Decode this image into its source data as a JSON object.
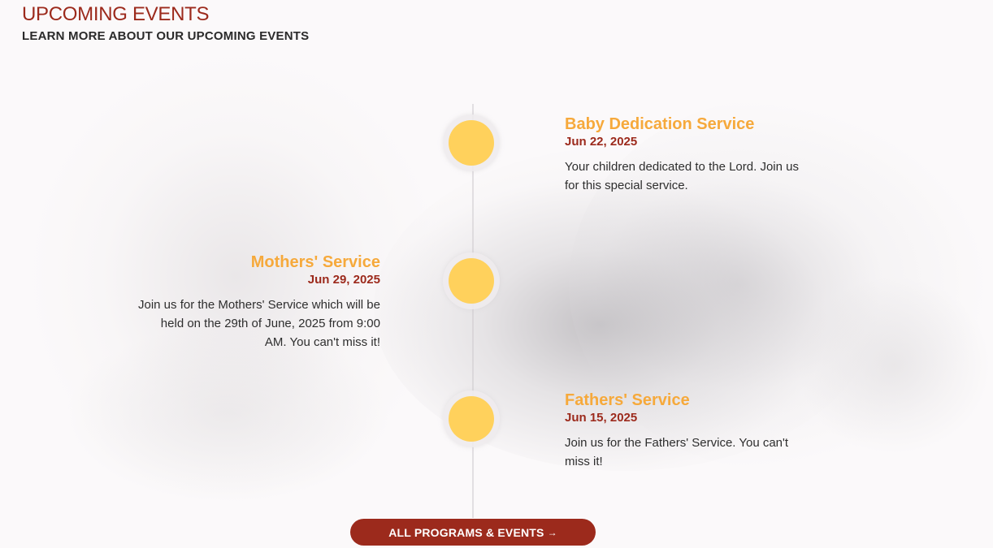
{
  "header": {
    "title": "UPCOMING EVENTS",
    "subtitle": "LEARN MORE ABOUT OUR UPCOMING EVENTS"
  },
  "events": [
    {
      "name": "Baby Dedication Service",
      "date": "Jun 22, 2025",
      "description": "Your children dedicated to the Lord. Join us for this special service."
    },
    {
      "name": "Mothers' Service",
      "date": "Jun 29, 2025",
      "description": "Join us for the Mothers' Service which will be held on the 29th of June, 2025 from 9:00 AM. You can't miss it!"
    },
    {
      "name": "Fathers' Service",
      "date": "Jun 15, 2025",
      "description": "Join us for the Fathers' Service. You can't miss it!"
    }
  ],
  "cta": {
    "label": "ALL PROGRAMS & EVENTS",
    "arrow": "→"
  },
  "colors": {
    "accent": "#9c2a1c",
    "event_title": "#f6a93b",
    "timeline_dot": "#ffd15c"
  }
}
